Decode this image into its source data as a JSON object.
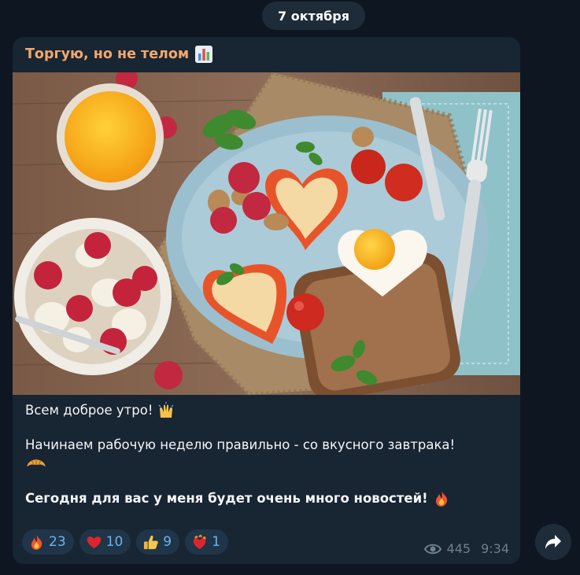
{
  "date_separator": "7 октября",
  "message": {
    "channel_title": "Торгую, но не телом",
    "lines": [
      "Всем доброе утро!",
      "Начинаем рабочую неделю правильно - со вкусного завтрака!",
      "Сегодня для вас у меня будет очень много новостей!"
    ],
    "reactions": [
      {
        "icon": "fire-icon",
        "count": "23"
      },
      {
        "icon": "red-heart-icon",
        "count": "10"
      },
      {
        "icon": "thumbs-up-icon",
        "count": "9"
      },
      {
        "icon": "heart-on-fire-icon",
        "count": "1"
      }
    ],
    "views": "445",
    "time": "9:34"
  },
  "colors": {
    "background": "#0e1621",
    "bubble": "#182533",
    "channel_title": "#f3a86b",
    "reaction_count": "#6ab3f3",
    "meta": "#6d7f8f"
  }
}
